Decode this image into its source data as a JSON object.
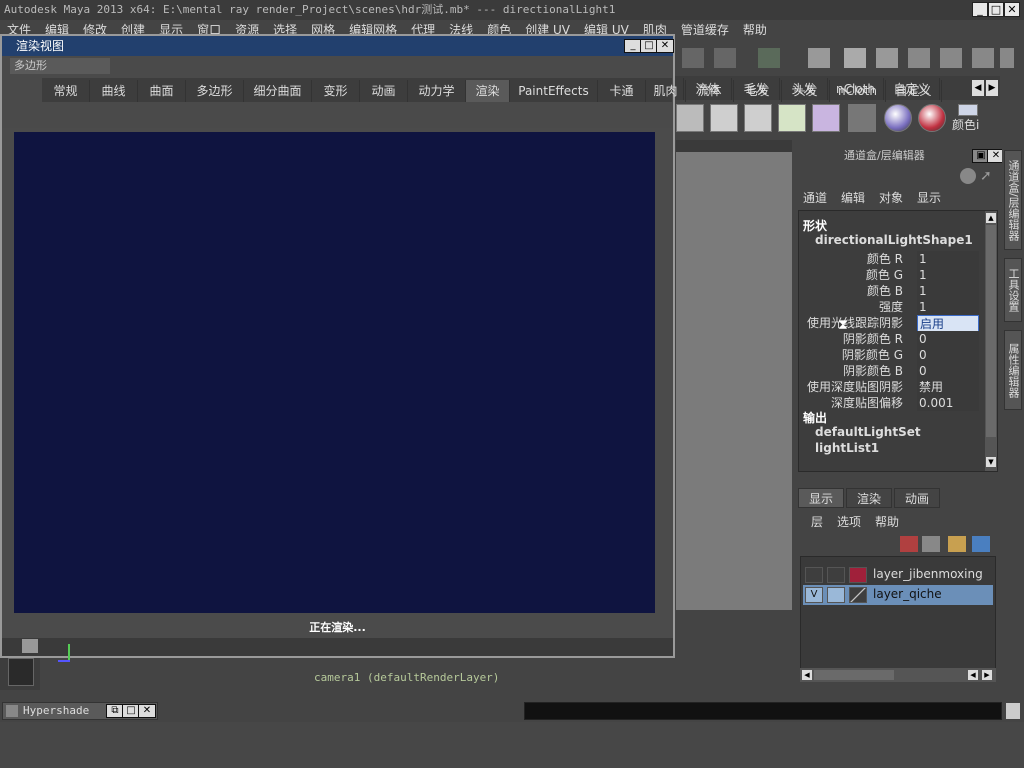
{
  "app": {
    "title": "Autodesk Maya 2013 x64: E:\\mental ray render_Project\\scenes\\hdr测试.mb*  ---  directionalLight1"
  },
  "menubar": [
    "文件",
    "编辑",
    "修改",
    "创建",
    "显示",
    "窗口",
    "资源",
    "选择",
    "网格",
    "编辑网格",
    "代理",
    "法线",
    "颜色",
    "创建 UV",
    "编辑 UV",
    "肌肉",
    "管道缓存",
    "帮助"
  ],
  "shelf": {
    "menuset": "多边形",
    "tabs": [
      "常规",
      "曲线",
      "曲面",
      "多边形",
      "细分曲面",
      "变形",
      "动画",
      "动力学",
      "渲染",
      "PaintEffects",
      "卡通",
      "肌肉",
      "流体",
      "毛发",
      "头发",
      "nCloth",
      "自定义"
    ],
    "active_tab": "渲染",
    "color_label": "颜色i"
  },
  "render_view": {
    "title": "渲染视图",
    "status": "正在渲染...",
    "image_color": "#0f1440"
  },
  "camera_label": "camera1 (defaultRenderLayer)",
  "channel_box": {
    "header": "通道盒/层编辑器",
    "menus": [
      "通道",
      "编辑",
      "对象",
      "显示"
    ],
    "section_shape": "形状",
    "shape_node": "directionalLightShape1",
    "attributes": [
      {
        "label": "颜色 R",
        "value": "1"
      },
      {
        "label": "颜色 G",
        "value": "1"
      },
      {
        "label": "颜色 B",
        "value": "1"
      },
      {
        "label": "强度",
        "value": "1"
      },
      {
        "label": "使用光线跟踪阴影",
        "value": "启用",
        "highlight": true
      },
      {
        "label": "阴影颜色 R",
        "value": "0"
      },
      {
        "label": "阴影颜色 G",
        "value": "0"
      },
      {
        "label": "阴影颜色 B",
        "value": "0"
      },
      {
        "label": "使用深度贴图阴影",
        "value": "禁用"
      },
      {
        "label": "深度贴图偏移",
        "value": "0.001"
      }
    ],
    "section_output": "输出",
    "outputs": [
      "defaultLightSet",
      "lightList1"
    ]
  },
  "vertical_tabs": [
    "通道盒/层编辑器",
    "工具设置",
    "属性编辑器"
  ],
  "layer_editor": {
    "tabs": [
      "显示",
      "渲染",
      "动画"
    ],
    "active_tab": "显示",
    "menus": [
      "层",
      "选项",
      "帮助"
    ],
    "layers": [
      {
        "name": "layer_jibenmoxing",
        "visible": "",
        "color": "#a0203a",
        "selected": false
      },
      {
        "name": "layer_qiche",
        "visible": "V",
        "color": "",
        "selected": true
      }
    ]
  },
  "bottom": {
    "hypershade": "Hypershade"
  },
  "colors": {
    "render_title_bar": "#22406e",
    "layer_selected": "#6b8fb8",
    "highlight_field": "#d9e4f5"
  }
}
